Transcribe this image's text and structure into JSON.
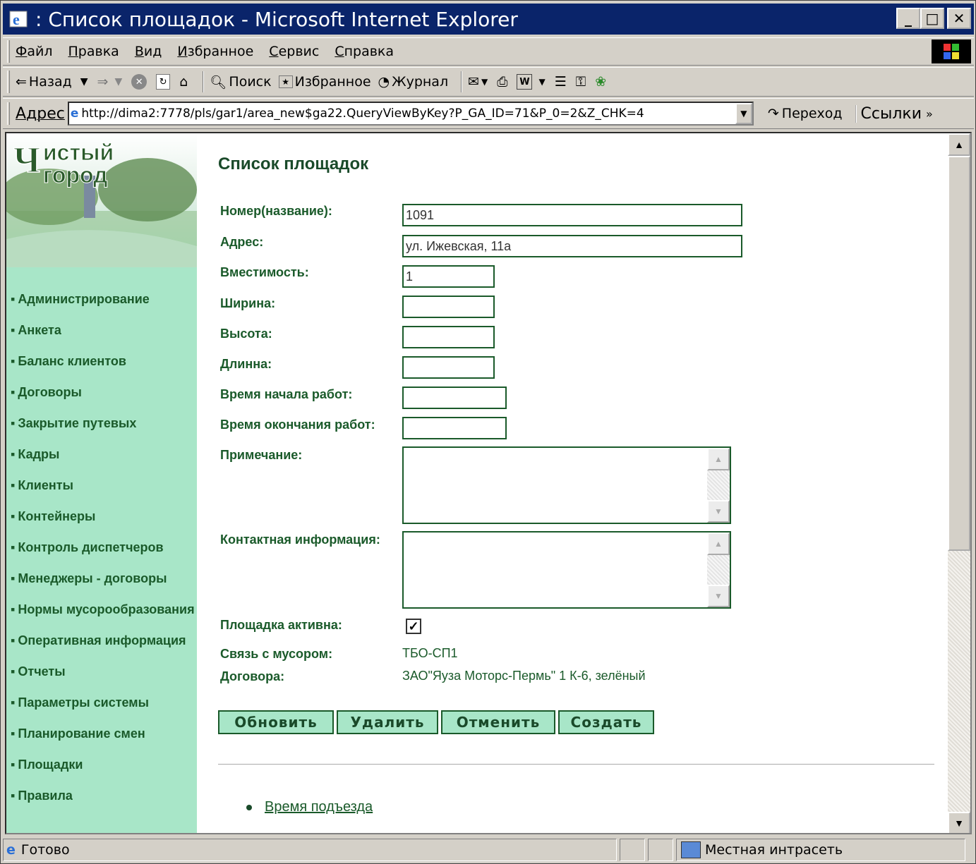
{
  "window": {
    "title": ": Список площадок - Microsoft Internet Explorer"
  },
  "menu": [
    "Файл",
    "Правка",
    "Вид",
    "Избранное",
    "Сервис",
    "Справка"
  ],
  "toolbar": {
    "back": "Назад",
    "search": "Поиск",
    "favorites": "Избранное",
    "history": "Журнал"
  },
  "address": {
    "label": "Адрес",
    "url": "http://dima2:7778/pls/gar1/area_new$ga22.QueryViewByKey?P_GA_ID=71&P_0=2&Z_CHK=4",
    "go": "Переход",
    "links": "Ссылки"
  },
  "sidebar": {
    "items": [
      "Администрирование",
      "Анкета",
      "Баланс клиентов",
      "Договоры",
      "Закрытие путевых",
      "Кадры",
      "Клиенты",
      "Контейнеры",
      "Контроль диспетчеров",
      "Менеджеры - договоры",
      "Нормы мусорообразования",
      "Оперативная информация",
      "Отчеты",
      "Параметры системы",
      "Планирование смен",
      "Площадки",
      "Правила"
    ]
  },
  "form": {
    "title": "Список площадок",
    "number_label": "Номер(название):",
    "number_value": "1091",
    "address_label": "Адрес:",
    "address_value": "ул. Ижевская, 11а",
    "capacity_label": "Вместимость:",
    "capacity_value": "1",
    "width_label": "Ширина:",
    "width_value": "",
    "height_label": "Высота:",
    "height_value": "",
    "length_label": "Длинна:",
    "length_value": "",
    "start_label": "Время начала работ:",
    "start_value": "",
    "end_label": "Время окончания работ:",
    "end_value": "",
    "note_label": "Примечание:",
    "contact_label": "Контактная информация:",
    "active_label": "Площадка активна:",
    "active_checked": true,
    "garbage_label": "Связь с мусором:",
    "garbage_value": "ТБО-СП1",
    "contracts_label": "Договора:",
    "contracts_value": "ЗАО\"Яуза Моторс-Пермь\" 1 К-6, зелёный"
  },
  "buttons": {
    "update": "Обновить",
    "delete": "Удалить",
    "cancel": "Отменить",
    "create": "Создать"
  },
  "links": {
    "arrival_time": "Время подъезда"
  },
  "status": {
    "text": "Готово",
    "zone": "Местная интрасеть"
  },
  "colors": {
    "titlebar": "#0a246a",
    "sidebar": "#a8e6c8",
    "label_green": "#1a5a2a"
  }
}
